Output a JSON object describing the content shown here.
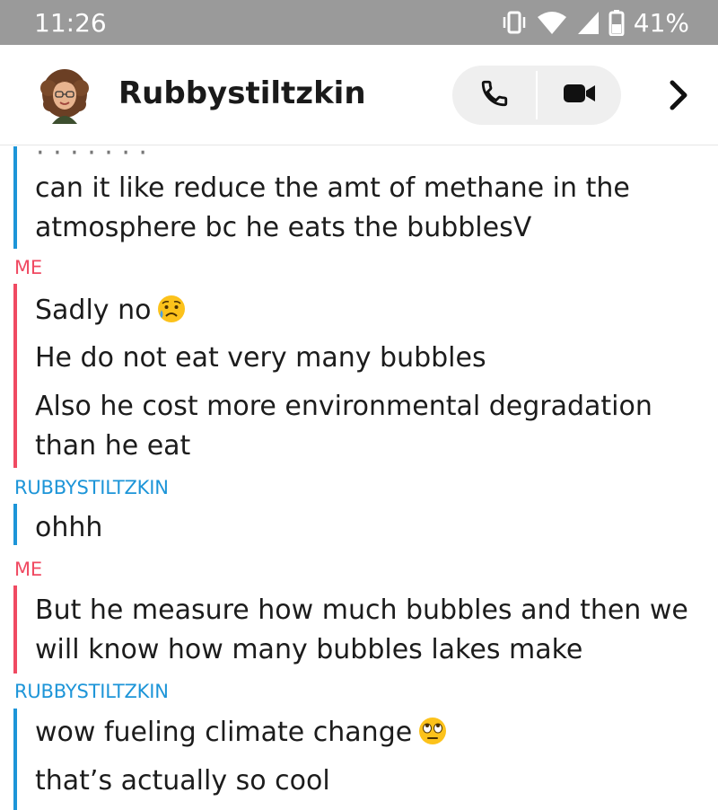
{
  "status_bar": {
    "time": "11:26",
    "battery": "41%"
  },
  "header": {
    "contact_name": "Rubbystiltzkin"
  },
  "chat": {
    "groups": [
      {
        "sender": "RUBBYSTILTZKIN",
        "is_me": false,
        "messages": [
          "can it like reduce the amt of methane in the",
          "atmosphere bc he eats the bubblesV"
        ]
      },
      {
        "sender": "ME",
        "is_me": true,
        "messages": [
          "Sadly no",
          "He do not eat very many bubbles",
          "Also he cost more environmental degradation",
          "than he eat"
        ]
      },
      {
        "sender": "RUBBYSTILTZKIN",
        "is_me": false,
        "messages": [
          "ohhh"
        ]
      },
      {
        "sender": "ME",
        "is_me": true,
        "messages": [
          "But he measure how much bubbles and then we",
          "will know how many bubbles lakes make"
        ]
      },
      {
        "sender": "RUBBYSTILTZKIN",
        "is_me": false,
        "messages": [
          "wow fueling climate change",
          "that’s actually so cool"
        ]
      }
    ]
  },
  "icons": {
    "status": [
      "vibrate-icon",
      "wifi-icon",
      "signal-icon",
      "battery-icon"
    ],
    "header": [
      "avatar",
      "phone-icon",
      "video-icon",
      "chevron-right-icon"
    ],
    "emoji": [
      "sad-sweat-emoji-icon",
      "eye-roll-emoji-icon"
    ]
  },
  "colors": {
    "me": "#f04a62",
    "them": "#1d95d8",
    "status_bar": "#9a9a9a"
  }
}
